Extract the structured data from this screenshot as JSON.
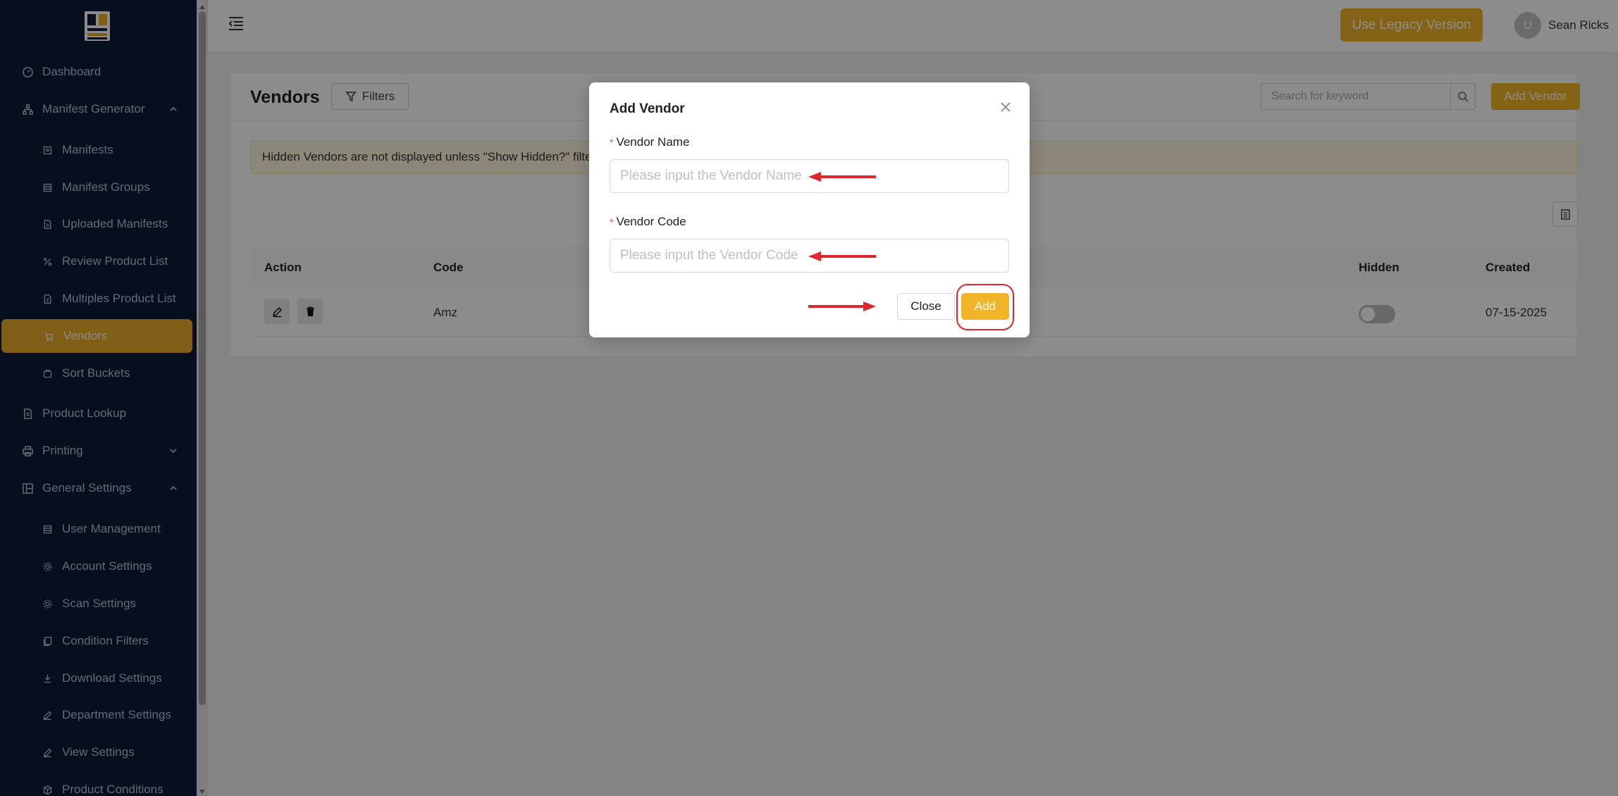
{
  "sidebar": {
    "items": [
      {
        "label": "Dashboard",
        "icon": "dashboard-icon",
        "level": 1
      },
      {
        "label": "Manifest Generator",
        "icon": "sitemap-icon",
        "level": 1,
        "expanded": true
      },
      {
        "label": "Manifests",
        "icon": "manifest-icon",
        "level": 2
      },
      {
        "label": "Manifest Groups",
        "icon": "group-icon",
        "level": 2
      },
      {
        "label": "Uploaded Manifests",
        "icon": "file-icon",
        "level": 2
      },
      {
        "label": "Review Product List",
        "icon": "percent-icon",
        "level": 2
      },
      {
        "label": "Multiples Product List",
        "icon": "file-icon",
        "level": 2
      },
      {
        "label": "Vendors",
        "icon": "cart-icon",
        "level": 2,
        "active": true
      },
      {
        "label": "Sort Buckets",
        "icon": "bucket-icon",
        "level": 2
      },
      {
        "label": "Product Lookup",
        "icon": "lookup-icon",
        "level": 1
      },
      {
        "label": "Printing",
        "icon": "printer-icon",
        "level": 1,
        "expanded": false
      },
      {
        "label": "General Settings",
        "icon": "settings-panel-icon",
        "level": 1,
        "expanded": true
      },
      {
        "label": "User Management",
        "icon": "users-icon",
        "level": 2
      },
      {
        "label": "Account Settings",
        "icon": "gear-icon",
        "level": 2
      },
      {
        "label": "Scan Settings",
        "icon": "gear-icon",
        "level": 2
      },
      {
        "label": "Condition Filters",
        "icon": "filter-doc-icon",
        "level": 2
      },
      {
        "label": "Download Settings",
        "icon": "download-icon",
        "level": 2
      },
      {
        "label": "Department Settings",
        "icon": "pencil-icon",
        "level": 2
      },
      {
        "label": "View Settings",
        "icon": "pencil-icon",
        "level": 2
      },
      {
        "label": "Product Conditions",
        "icon": "box-icon",
        "level": 2
      }
    ]
  },
  "topbar": {
    "legacy_label": "Use Legacy Version",
    "avatar_initial": "U",
    "username": "Sean Ricks"
  },
  "page": {
    "title": "Vendors",
    "filters_label": "Filters",
    "search_placeholder": "Search for keyword",
    "add_vendor_label": "Add Vendor",
    "alert_text": "Hidden Vendors are not displayed unless \"Show Hidden?\" filter"
  },
  "table": {
    "headers": {
      "action": "Action",
      "code": "Code",
      "hidden": "Hidden",
      "created": "Created"
    },
    "rows": [
      {
        "code": "Amz",
        "hidden": false,
        "created": "07-15-2025"
      }
    ]
  },
  "modal": {
    "title": "Add Vendor",
    "vendor_name_label": "Vendor Name",
    "vendor_name_placeholder": "Please input the Vendor Name",
    "vendor_code_label": "Vendor Code",
    "vendor_code_placeholder": "Please input the Vendor Code",
    "close_label": "Close",
    "add_label": "Add",
    "required_mark": "*"
  },
  "colors": {
    "sidebar_bg": "#0e1a36",
    "accent": "#f0b428",
    "annotation_red": "#e0262a"
  }
}
